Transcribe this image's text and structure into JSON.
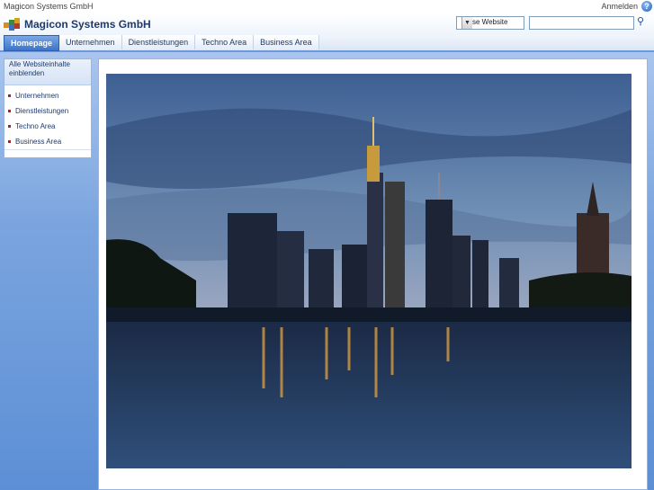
{
  "topbar": {
    "site_name": "Magicon Systems GmbH",
    "signin": "Anmelden",
    "help": "?"
  },
  "header": {
    "brand": "Magicon Systems GmbH"
  },
  "search": {
    "scope": "Diese Website",
    "value": ""
  },
  "nav": {
    "tabs": [
      {
        "label": "Homepage",
        "active": true
      },
      {
        "label": "Unternehmen"
      },
      {
        "label": "Dienstleistungen"
      },
      {
        "label": "Techno Area"
      },
      {
        "label": "Business Area"
      }
    ]
  },
  "quicklaunch": {
    "title": "Alle Websiteinhalte einblenden",
    "items": [
      "Unternehmen",
      "Dienstleistungen",
      "Techno Area",
      "Business Area"
    ]
  },
  "colors": {
    "accent": "#3c74c9",
    "page_bg": "#7aa4de",
    "bullet": "#b02020"
  }
}
